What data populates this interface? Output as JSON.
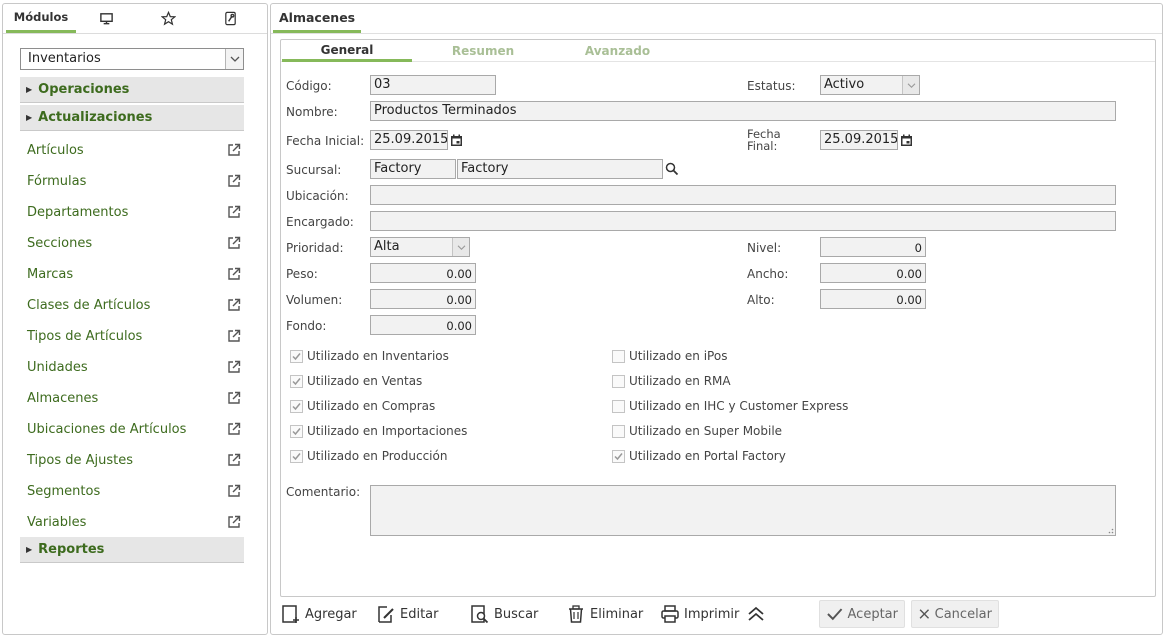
{
  "left": {
    "tabs": [
      {
        "label": "Módulos",
        "active": true
      },
      {
        "icon": "monitor-icon"
      },
      {
        "icon": "star-icon"
      },
      {
        "icon": "wrench-icon"
      }
    ],
    "module_select": "Inventarios",
    "sections": {
      "operaciones": "Operaciones",
      "actualizaciones": "Actualizaciones",
      "reportes": "Reportes"
    },
    "items": [
      "Artículos",
      "Fórmulas",
      "Departamentos",
      "Secciones",
      "Marcas",
      "Clases de Artículos",
      "Tipos de Artículos",
      "Unidades",
      "Almacenes",
      "Ubicaciones de Artículos",
      "Tipos de Ajustes",
      "Segmentos",
      "Variables"
    ]
  },
  "right": {
    "title": "Almacenes",
    "tabs": [
      "General",
      "Resumen",
      "Avanzado"
    ],
    "active_tab": "General",
    "form": {
      "codigo_label": "Código:",
      "codigo": "03",
      "estatus_label": "Estatus:",
      "estatus": "Activo",
      "nombre_label": "Nombre:",
      "nombre": "Productos Terminados",
      "fecha_inicial_label": "Fecha Inicial:",
      "fecha_inicial": "25.09.2015",
      "fecha_final_label_1": "Fecha",
      "fecha_final_label_2": "Final:",
      "fecha_final": "25.09.2015",
      "sucursal_label": "Sucursal:",
      "sucursal_code": "Factory",
      "sucursal_name": "Factory",
      "ubicacion_label": "Ubicación:",
      "ubicacion": "",
      "encargado_label": "Encargado:",
      "encargado": "",
      "prioridad_label": "Prioridad:",
      "prioridad": "Alta",
      "nivel_label": "Nivel:",
      "nivel": "0",
      "peso_label": "Peso:",
      "peso": "0.00",
      "ancho_label": "Ancho:",
      "ancho": "0.00",
      "volumen_label": "Volumen:",
      "volumen": "0.00",
      "alto_label": "Alto:",
      "alto": "0.00",
      "fondo_label": "Fondo:",
      "fondo": "0.00",
      "comentario_label": "Comentario:",
      "comentario": ""
    },
    "checks_left": [
      {
        "label": "Utilizado en Inventarios",
        "checked": true
      },
      {
        "label": "Utilizado en Ventas",
        "checked": true
      },
      {
        "label": "Utilizado en Compras",
        "checked": true
      },
      {
        "label": "Utilizado en Importaciones",
        "checked": true
      },
      {
        "label": "Utilizado en Producción",
        "checked": true
      }
    ],
    "checks_right": [
      {
        "label": "Utilizado en iPos",
        "checked": false
      },
      {
        "label": "Utilizado en RMA",
        "checked": false
      },
      {
        "label": "Utilizado en IHC y Customer Express",
        "checked": false
      },
      {
        "label": "Utilizado en Super Mobile",
        "checked": false
      },
      {
        "label": "Utilizado en Portal Factory",
        "checked": true
      }
    ],
    "toolbar": {
      "agregar": "Agregar",
      "editar": "Editar",
      "buscar": "Buscar",
      "eliminar": "Eliminar",
      "imprimir": "Imprimir",
      "aceptar": "Aceptar",
      "cancelar": "Cancelar"
    }
  },
  "colors": {
    "accent": "#86b95a",
    "link": "#3d6b1e",
    "muted_tab": "#a9bf96"
  }
}
